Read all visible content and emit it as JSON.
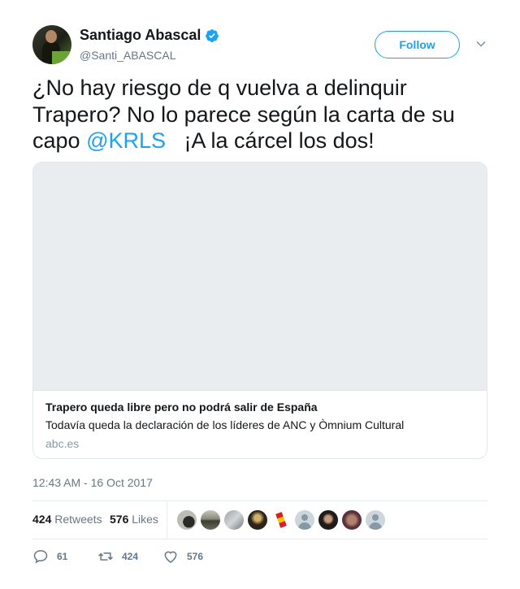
{
  "user": {
    "display_name": "Santiago Abascal",
    "handle": "@Santi_ABASCAL",
    "verified": true
  },
  "follow_label": "Follow",
  "tweet": {
    "text_before": "¿No hay riesgo de q vuelva a delinquir Trapero? No lo parece según la carta de su capo ",
    "mention": "@KRLS",
    "text_after": "   ¡A la cárcel los dos!"
  },
  "card": {
    "title": "Trapero queda libre pero no podrá salir de España",
    "description": "Todavía queda la declaración de los líderes de ANC y Òmnium Cultural",
    "domain": "abc.es"
  },
  "timestamp": "12:43 AM - 16 Oct 2017",
  "stats": {
    "retweets_count": "424",
    "retweets_label": "Retweets",
    "likes_count": "576",
    "likes_label": "Likes"
  },
  "actions": {
    "reply_count": "61",
    "retweet_count": "424",
    "like_count": "576"
  },
  "colors": {
    "accent": "#1da1f2",
    "muted": "#657786"
  }
}
